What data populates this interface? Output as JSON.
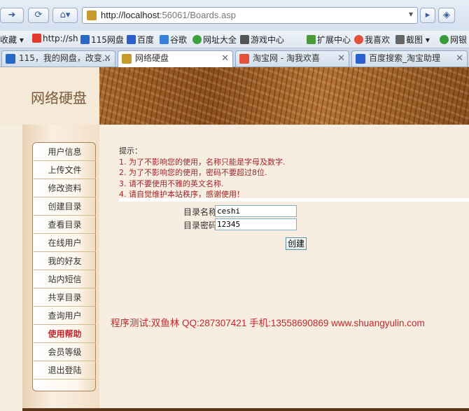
{
  "browser": {
    "url_host": "http://localhost",
    "url_rest": ":56061/Boards.asp",
    "bookmarks": [
      "收藏",
      "http://sh",
      "115网盘",
      "百度",
      "谷歌",
      "网址大全",
      "游戏中心",
      "扩展中心",
      "我喜欢",
      "截图",
      "网银"
    ],
    "tabs": [
      "115，我的网盘，改变...",
      "网络硬盘",
      "淘宝网 - 淘我欢喜",
      "百度搜索_淘宝助理"
    ]
  },
  "header": {
    "logo_text": "网络硬盘"
  },
  "sidebar": {
    "items": [
      "用户信息",
      "上传文件",
      "修改资料",
      "创建目录",
      "查看目录",
      "在线用户",
      "我的好友",
      "站内短信",
      "共享目录",
      "查询用户",
      "使用帮助",
      "会员等级",
      "退出登陆"
    ],
    "active_index": 10
  },
  "tips": {
    "heading": "提示：",
    "lines": [
      {
        "num": "1.",
        "text": "为了不影响您的使用，名称只能是字母及数字."
      },
      {
        "num": "2.",
        "text": "为了不影响您的使用，密码不要超过8位."
      },
      {
        "num": "3.",
        "text": "请不要使用不雅的英文名称."
      },
      {
        "num": "4.",
        "text": "请自觉维护本站秩序，感谢使用！"
      }
    ]
  },
  "form": {
    "name_label": "目录名称",
    "name_value": "ceshi",
    "password_label": "目录密码",
    "password_value": "12345",
    "create_button": "创建"
  },
  "footer": {
    "credit": "程序测试:双鱼林 QQ:287307421 手机:13558690869 www.shuangyulin.com"
  },
  "colors": {
    "accent_red": "#c0282d",
    "banner_brown": "#8c4f1e"
  }
}
